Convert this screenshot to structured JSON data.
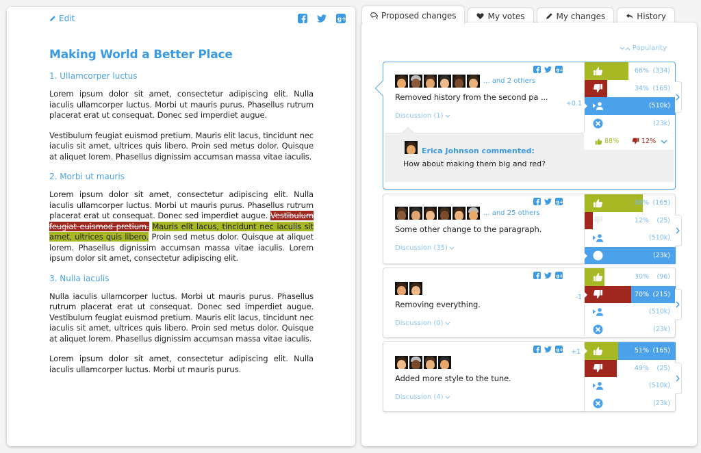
{
  "document": {
    "edit_label": "Edit",
    "social": [
      "facebook-icon",
      "twitter-icon",
      "google-plus-icon"
    ],
    "title": "Making World a Better Place",
    "sections": [
      {
        "heading": "1. Ullamcorper luctus",
        "paragraphs": [
          "Lorem ipsum dolor sit amet, consectetur adipiscing elit. Nulla iaculis ullamcorper luctus. Morbi ut mauris purus. Phasellus rutrum placerat erat ut consequat. Donec sed imperdiet augue.",
          "Vestibulum feugiat euismod pretium. Mauris elit lacus, tincidunt nec iaculis sit amet, ultrices quis libero. Proin sed metus dolor. Quisque at aliquet lorem. Phasellus dignissim accumsan massa vitae iaculis."
        ]
      },
      {
        "heading": "2. Morbi ut mauris",
        "paragraph_parts": {
          "before": "Lorem ipsum dolor sit amet, consectetur adipiscing elit. Nulla iaculis ullamcorper luctus. Morbi ut mauris purus. Phasellus rutrum placerat erat ut consequat. Donec sed imperdiet augue. ",
          "deleted": "Vestibulum feugiat euismod pretium.",
          "inserted": "Mauris elit lacus, tincidunt nec iaculis sit amet, ultrices quis libero.",
          "after": " Proin sed metus dolor. Quisque at aliquet lorem. Phasellus dignissim accumsan massa vitae iaculis. Lorem ipsum dolor sit amet, consectetur adipiscing elit."
        }
      },
      {
        "heading": "3. Nulla iaculis",
        "paragraphs": [
          "Nulla iaculis ullamcorper luctus. Morbi ut mauris purus. Phasellus rutrum placerat erat ut consequat. Donec sed imperdiet augue. Vestibulum feugiat euismod pretium. Mauris elit lacus, tincidunt nec iaculis sit amet, ultrices quis libero. Proin sed metus dolor. Quisque at aliquet lorem. Phasellus dignissim accumsan massa vitae iaculis.",
          "Lorem ipsum dolor sit amet, consectetur adipiscing elit. Nulla iaculis ullamcorper luctus. Morbi ut mauris purus."
        ]
      }
    ]
  },
  "tabs": [
    {
      "label": "Proposed changes",
      "icon": "comments-icon",
      "active": true
    },
    {
      "label": "My votes",
      "icon": "heart-icon",
      "active": false
    },
    {
      "label": "My changes",
      "icon": "pencil-icon",
      "active": false
    },
    {
      "label": "History",
      "icon": "reply-icon",
      "active": false
    }
  ],
  "sort": {
    "label": "Popularity"
  },
  "colors": {
    "accent": "#3b9ae1",
    "approve": "#a7b825",
    "reject": "#a0271e",
    "highlight": "#4ba2ea"
  },
  "changes": [
    {
      "description": "Removed history from the second pa ...",
      "avatar_count": 6,
      "others": "... and 2 others",
      "discussion": "Discussion (1)",
      "score": "+0.1",
      "selected": true,
      "votes": {
        "up": {
          "pct": "66%",
          "count": "(334)",
          "fraction": 0.66
        },
        "down": {
          "pct": "34%",
          "count": "(165)",
          "fraction": 0.34
        },
        "delegate": {
          "count": "(510k)"
        },
        "abstain": {
          "count": "(23k)"
        },
        "highlighted": "delegate"
      },
      "comment": {
        "author": "Erica Johnson commented:",
        "text": "How about making them big and red?"
      },
      "summary": {
        "up": "88%",
        "down": "12%"
      }
    },
    {
      "description": "Some other change to the paragraph.",
      "avatar_count": 6,
      "others": "... and 25 others",
      "discussion": "Discussion (35)",
      "score": "",
      "votes": {
        "up": {
          "pct": "88%",
          "count": "(165)",
          "fraction": 0.88
        },
        "down": {
          "pct": "12%",
          "count": "(25)",
          "fraction": 0.12
        },
        "delegate": {
          "count": "(510k)"
        },
        "abstain": {
          "count": "(23k)"
        },
        "highlighted": "abstain"
      }
    },
    {
      "description": "Removing everything.",
      "avatar_count": 2,
      "others": "",
      "discussion": "Discussion (0)",
      "score": "-1",
      "votes": {
        "up": {
          "pct": "30%",
          "count": "(96)",
          "fraction": 0.3
        },
        "down": {
          "pct": "70%",
          "count": "(215)",
          "fraction": 0.7
        },
        "delegate": {
          "count": "(510k)"
        },
        "abstain": {
          "count": "(23k)"
        },
        "highlighted": "down"
      }
    },
    {
      "description": "Added more style to the tune.",
      "avatar_count": 4,
      "others": "",
      "discussion": "Discussion (4)",
      "score": "+1",
      "votes": {
        "up": {
          "pct": "51%",
          "count": "(165)",
          "fraction": 0.51
        },
        "down": {
          "pct": "49%",
          "count": "(25)",
          "fraction": 0.49
        },
        "delegate": {
          "count": "(510k)"
        },
        "abstain": {
          "count": "(23k)"
        },
        "highlighted": "up"
      }
    }
  ]
}
